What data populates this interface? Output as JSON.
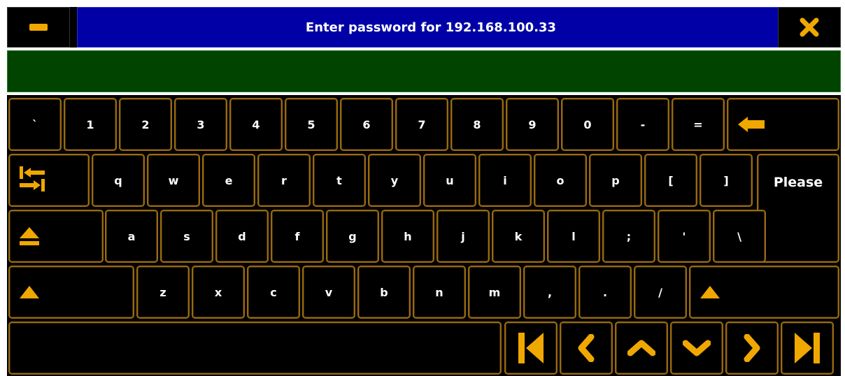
{
  "titlebar": {
    "title": "Enter password for 192.168.100.33",
    "minimize_icon": "minus-icon",
    "close_icon": "close-x-icon"
  },
  "input": {
    "value": ""
  },
  "colors": {
    "title_bg": "#0000a6",
    "input_bg": "#004400",
    "key_border": "#9a6a10",
    "accent": "#f0a800",
    "text": "#ffffff"
  },
  "keys": {
    "row1": [
      "`",
      "1",
      "2",
      "3",
      "4",
      "5",
      "6",
      "7",
      "8",
      "9",
      "0",
      "-",
      "="
    ],
    "row2": [
      "q",
      "w",
      "e",
      "r",
      "t",
      "y",
      "u",
      "i",
      "o",
      "p",
      "[",
      "]"
    ],
    "row3": [
      "a",
      "s",
      "d",
      "f",
      "g",
      "h",
      "j",
      "k",
      "l",
      ";",
      "'",
      "\\"
    ],
    "row4": [
      "z",
      "x",
      "c",
      "v",
      "b",
      "n",
      "m",
      ",",
      ".",
      "/"
    ],
    "enter_label": "Please"
  },
  "icons": {
    "backspace": "backspace-arrow-icon",
    "tab": "tab-icon",
    "capslock": "caps-lock-icon",
    "shift": "shift-icon",
    "first": "skip-to-start-icon",
    "left": "chevron-left-icon",
    "up": "chevron-up-icon",
    "down": "chevron-down-icon",
    "right": "chevron-right-icon",
    "last": "skip-to-end-icon"
  }
}
